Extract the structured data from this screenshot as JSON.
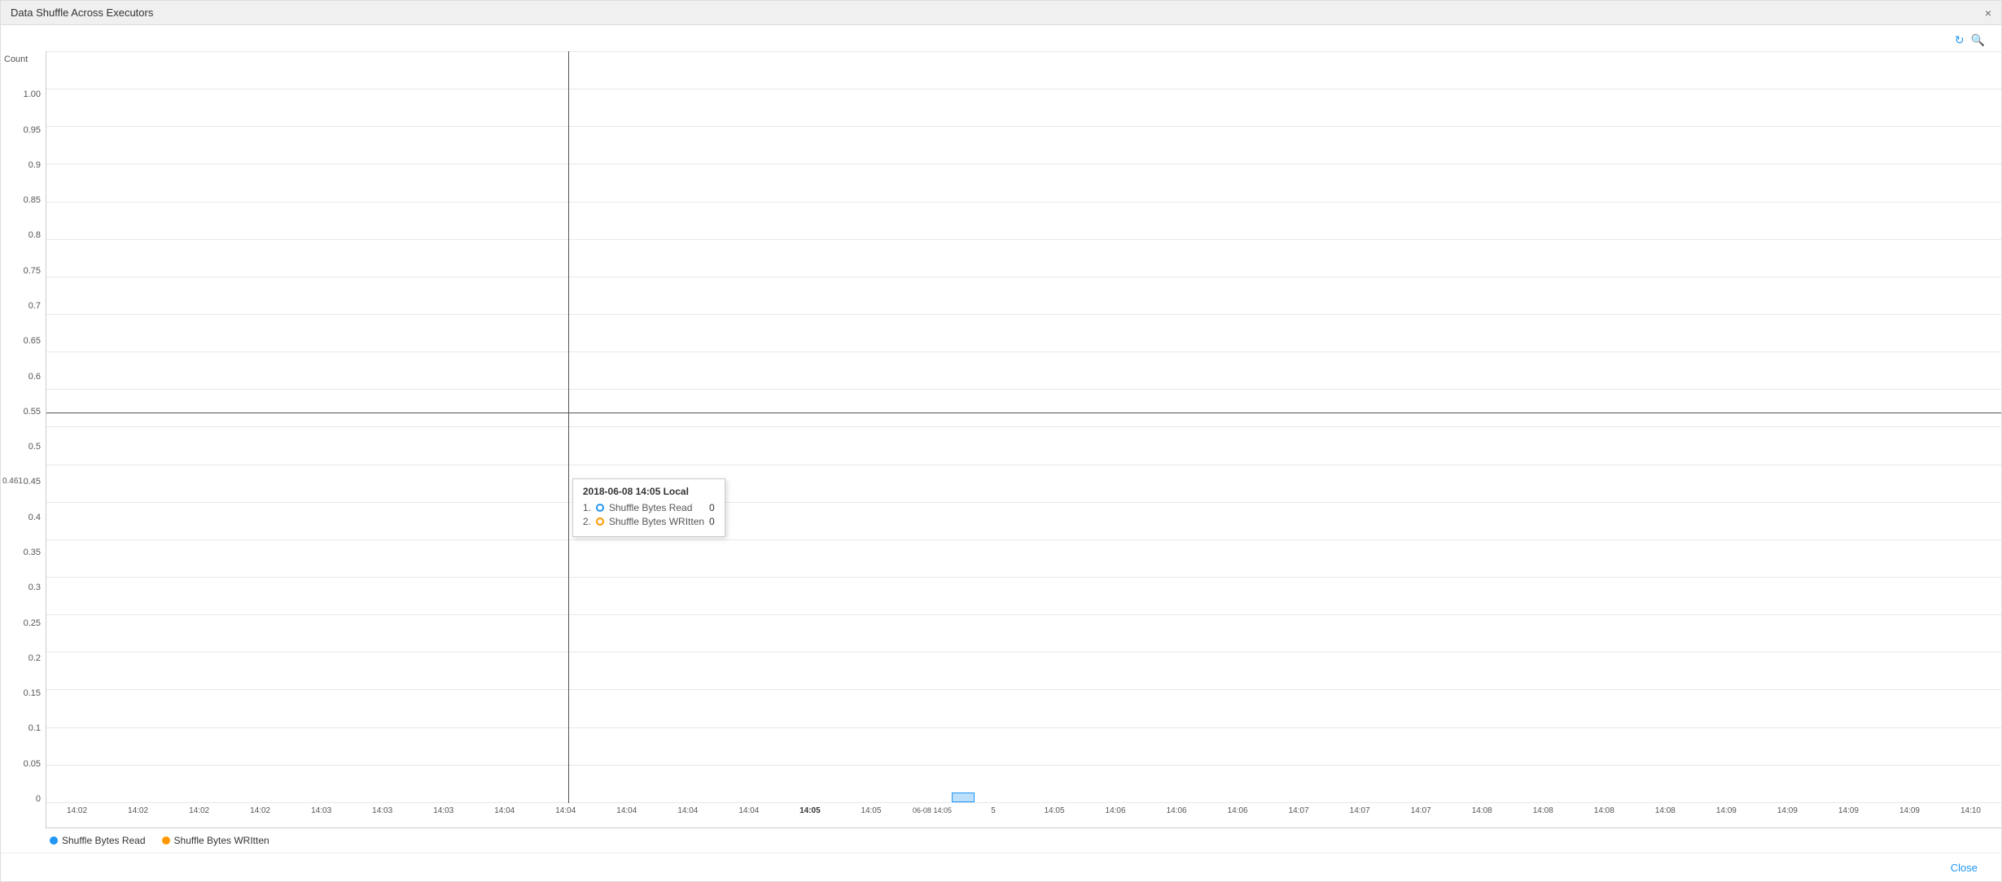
{
  "window": {
    "title": "Data Shuffle Across Executors",
    "close_label": "×"
  },
  "toolbar": {
    "refresh_icon": "↻",
    "zoom_icon": "🔍"
  },
  "chart": {
    "y_axis_label": "Count",
    "crosshair_value": "0.461",
    "y_labels": [
      "1.00",
      "0.95",
      "0.9",
      "0.85",
      "0.8",
      "0.75",
      "0.7",
      "0.65",
      "0.6",
      "0.55",
      "0.5",
      "0.45",
      "0.4",
      "0.35",
      "0.3",
      "0.25",
      "0.2",
      "0.15",
      "0.1",
      "0.05",
      "0"
    ],
    "x_labels": [
      "14:02",
      "14:02",
      "14:02",
      "14:02",
      "14:03",
      "14:03",
      "14:03",
      "14:04",
      "14:04",
      "14:04",
      "14:04",
      "14:04",
      "14:05",
      "14:05",
      "14:05",
      "14:05",
      "14:06",
      "14:06",
      "14:06",
      "14:07",
      "14:07",
      "14:07",
      "14:08",
      "14:08",
      "14:08",
      "14:08",
      "14:09",
      "14:09",
      "14:09",
      "14:09",
      "14:10"
    ]
  },
  "tooltip": {
    "title": "2018-06-08 14:05 Local",
    "row1_index": "1.",
    "row1_label": "Shuffle Bytes Read",
    "row1_value": "0",
    "row2_index": "2.",
    "row2_label": "Shuffle Bytes WRItten",
    "row2_value": "0"
  },
  "legend": {
    "item1_label": "Shuffle Bytes Read",
    "item2_label": "Shuffle Bytes WRItten"
  },
  "footer": {
    "close_label": "Close"
  }
}
